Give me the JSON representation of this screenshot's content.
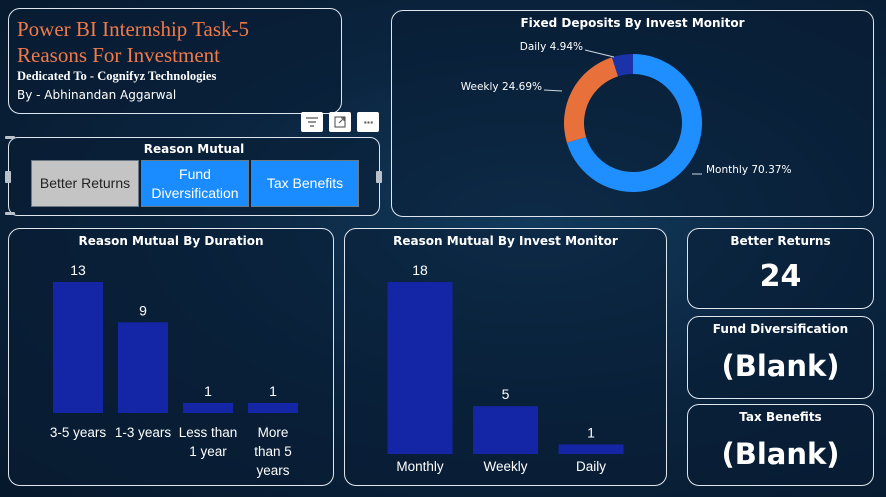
{
  "header": {
    "title_line1": "Power BI Internship Task-5",
    "title_line2": "Reasons For Investment",
    "dedication": "Dedicated To - Cognifyz Technologies",
    "author": "By - Abhinandan Aggarwal"
  },
  "slicer": {
    "title": "Reason Mutual",
    "options": [
      {
        "label": "Better Returns",
        "selected": true
      },
      {
        "label": "Fund\nDiversification",
        "selected": false
      },
      {
        "label": "Tax Benefits",
        "selected": false
      }
    ]
  },
  "toolbar": {
    "filter_icon": "filter-icon",
    "focus_icon": "focus-mode-icon",
    "more_icon": "more-options-icon",
    "more_label": "···"
  },
  "colors": {
    "accent_orange": "#ef7a4a",
    "donut_blue": "#1f8fff",
    "donut_orange": "#e8703a",
    "donut_navy": "#1a33a8",
    "bar_blue": "#1426a5",
    "slicer_selected": "#c4c4c4",
    "slicer_unselected": "#1a8cff"
  },
  "kpis": [
    {
      "title": "Better Returns",
      "value": "24"
    },
    {
      "title": "Fund Diversification",
      "value": "(Blank)"
    },
    {
      "title": "Tax Benefits",
      "value": "(Blank)"
    }
  ],
  "chart_data": [
    {
      "type": "pie",
      "title": "Fixed Deposits By Invest Monitor",
      "categories": [
        "Monthly",
        "Weekly",
        "Daily"
      ],
      "values": [
        70.37,
        24.69,
        4.94
      ],
      "labels": [
        "Monthly 70.37%",
        "Weekly 24.69%",
        "Daily 4.94%"
      ],
      "donut": true
    },
    {
      "type": "bar",
      "title": "Reason Mutual By Duration",
      "categories": [
        "3-5 years",
        "1-3 years",
        "Less than 1 year",
        "More than 5 years"
      ],
      "category_lines": [
        [
          "3-5 years"
        ],
        [
          "1-3 years"
        ],
        [
          "Less than",
          "1 year"
        ],
        [
          "More",
          "than 5",
          "years"
        ]
      ],
      "values": [
        13,
        9,
        1,
        1
      ],
      "ylim": [
        0,
        13
      ]
    },
    {
      "type": "bar",
      "title": "Reason Mutual By Invest Monitor",
      "categories": [
        "Monthly",
        "Weekly",
        "Daily"
      ],
      "category_lines": [
        [
          "Monthly"
        ],
        [
          "Weekly"
        ],
        [
          "Daily"
        ]
      ],
      "values": [
        18,
        5,
        1
      ],
      "ylim": [
        0,
        18
      ]
    }
  ]
}
